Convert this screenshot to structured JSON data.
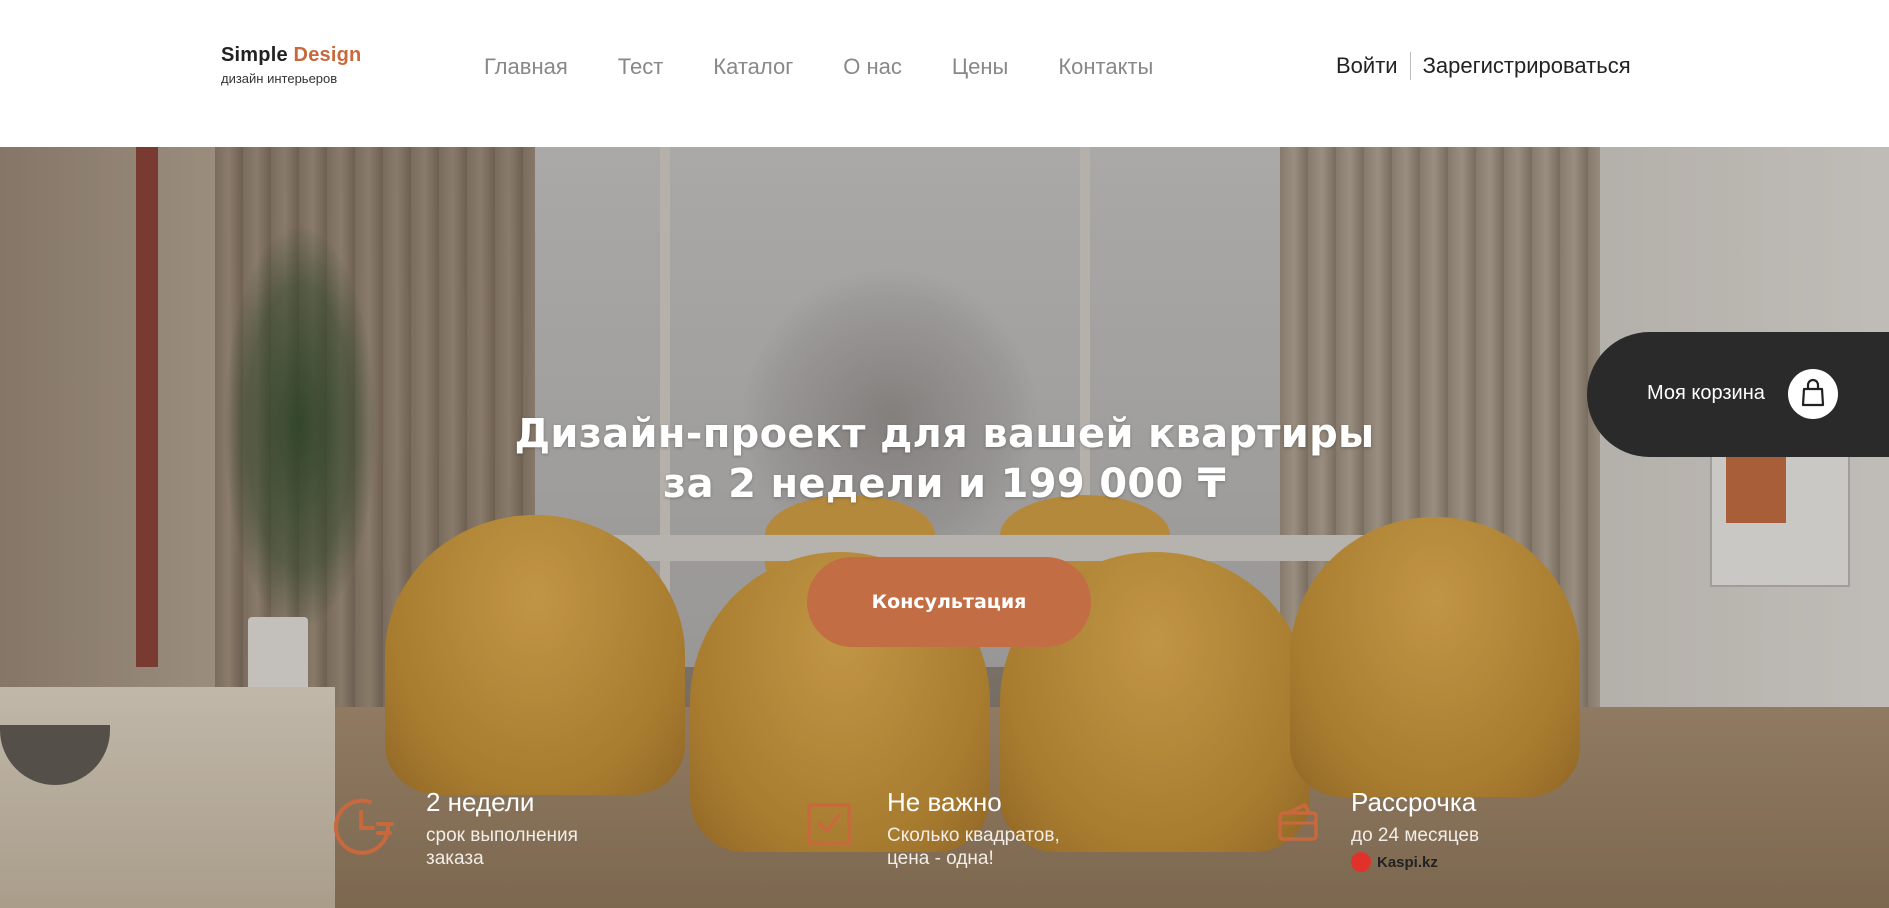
{
  "header": {
    "logo": {
      "brand_part1": "Simple",
      "brand_part2": "Design",
      "tagline": "дизайн интерьеров"
    },
    "nav": [
      "Главная",
      "Тест",
      "Каталог",
      "О нас",
      "Цены",
      "Контакты"
    ],
    "auth": {
      "login": "Войти",
      "register": "Зарегистрироваться"
    }
  },
  "hero": {
    "title_line1": "Дизайн-проект для вашей квартиры",
    "title_line2": "за 2 недели и 199 000 ₸",
    "cta": "Консультация"
  },
  "cart": {
    "label": "Моя корзина",
    "icon": "shopping-bag-icon"
  },
  "features": [
    {
      "title": "2 недели",
      "line1": "срок выполнения",
      "line2": "заказа",
      "icon": "clock-icon"
    },
    {
      "title": "Не важно",
      "line1": "Сколько квадратов,",
      "line2": "цена - одна!",
      "icon": "checkbox-icon"
    },
    {
      "title": "Рассрочка",
      "line1": "до 24 месяцев",
      "badge": "Kaspi.kz",
      "icon": "wallet-icon"
    }
  ],
  "colors": {
    "accent": "#c8693d",
    "cart_bg": "#2a2a2a",
    "cta_bg": "#c36d45"
  }
}
